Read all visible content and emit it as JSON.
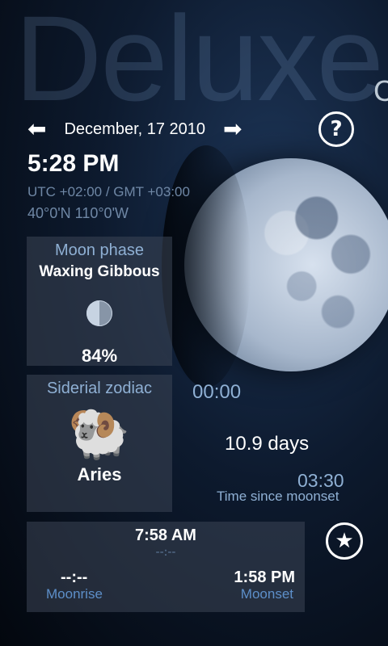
{
  "app": {
    "title": "Deluxe",
    "title_tail": "C"
  },
  "header": {
    "date": "December, 17 2010",
    "prev_icon": "arrow-left-icon",
    "next_icon": "arrow-right-icon",
    "help_icon": "question-icon",
    "help_label": "?"
  },
  "clock": {
    "time": "5:28 PM",
    "utc": "UTC +02:00 / GMT +03:00",
    "coords": "40°0'N 110°0'W"
  },
  "phase": {
    "title": "Moon phase",
    "name": "Waxing Gibbous",
    "percent": "84%",
    "icon": "moon-phase-icon"
  },
  "zodiac": {
    "title": "Siderial zodiac",
    "sign": "Aries",
    "icon": "ram-icon",
    "glyph": "🐏"
  },
  "info": {
    "timer": "00:00",
    "age": "10.9 days",
    "since_moonset_value": "03:30",
    "since_moonset_label": "Time since moonset"
  },
  "rise_set": {
    "center_time": "7:58 AM",
    "center_sub": "--:--",
    "moonrise_value": "--:--",
    "moonrise_label": "Moonrise",
    "moonset_value": "1:58 PM",
    "moonset_label": "Moonset"
  },
  "favorite": {
    "icon": "star-icon",
    "glyph": "★"
  }
}
